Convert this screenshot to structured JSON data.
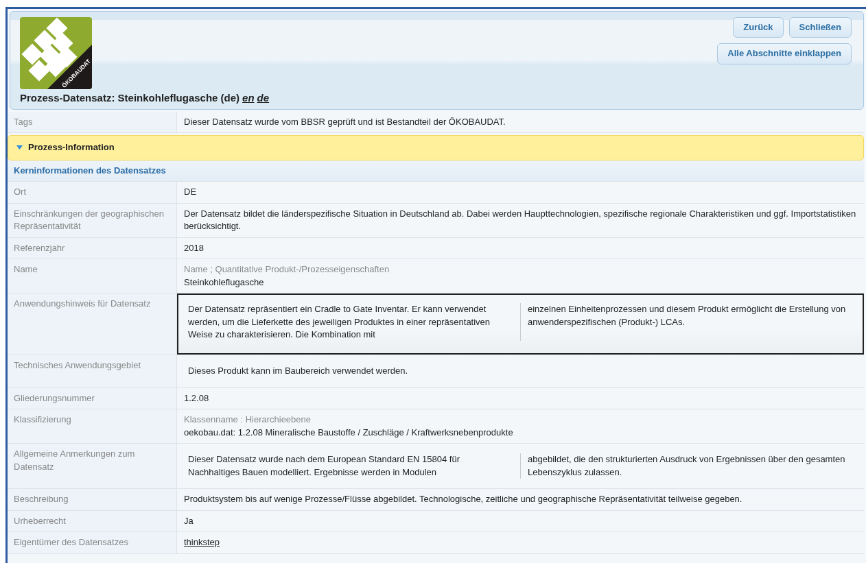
{
  "header": {
    "logo_text": "ÖKOBAUDAT",
    "title": "Prozess-Datensatz: Steinkohleflugasche (de)",
    "languages": [
      {
        "label": "en"
      },
      {
        "label": "de"
      }
    ],
    "buttons": [
      {
        "label": "Zurück"
      },
      {
        "label": "Schließen"
      },
      {
        "label": "Alle Abschnitte einklappen"
      }
    ]
  },
  "tags": {
    "label": "Tags",
    "value": "Dieser Datensatz wurde vom BBSR geprüft und ist Bestandteil der ÖKOBAUDAT."
  },
  "section": {
    "title": "Prozess-Information",
    "expanded": true
  },
  "subsection": "Kerninformationen des Datensatzes",
  "rows": [
    {
      "kind": "text",
      "label": "Ort",
      "value": "DE",
      "focused": false
    },
    {
      "kind": "text",
      "label": "Einschränkungen der geographischen Repräsentativität",
      "value": "Der Datensatz bildet die länderspezifische Situation in Deutschland ab. Dabei werden Haupttechnologien, spezifische regionale Charakteristiken und ggf. Importstatistiken berücksichtigt.",
      "focused": false
    },
    {
      "kind": "text",
      "label": "Referenzjahr",
      "value": "2018",
      "focused": false
    },
    {
      "kind": "qualified",
      "label": "Name",
      "caption": [
        "Name",
        "Quantitative Produkt-/Prozesseigenschaften"
      ],
      "separator": ";",
      "value": "Steinkohleflugasche",
      "focused": false
    },
    {
      "kind": "columns",
      "label": "Anwendungshinweis für Datensatz",
      "columns": [
        "Der Datensatz repräsentiert ein Cradle to Gate Inventar. Er kann verwendet werden, um die Lieferkette des jeweiligen Produktes in einer repräsentativen Weise zu charakterisieren. Die Kombination mit",
        "einzelnen Einheitenprozessen und diesem Produkt ermöglicht die Erstellung von anwenderspezifischen (Produkt-) LCAs."
      ],
      "focused": true
    },
    {
      "kind": "columns",
      "label": "Technisches Anwendungsgebiet",
      "columns": [
        "Dieses Produkt kann im Baubereich verwendet werden."
      ],
      "focused": false
    },
    {
      "kind": "text",
      "label": "Gliederungsnummer",
      "value": "1.2.08",
      "focused": false
    },
    {
      "kind": "qualified",
      "label": "Klassifizierung",
      "caption": [
        "Klassenname",
        "Hierarchieebene"
      ],
      "separator": ":",
      "value": "oekobau.dat: 1.2.08 Mineralische Baustoffe / Zuschläge / Kraftwerksnebenprodukte",
      "focused": false
    },
    {
      "kind": "columns",
      "label": "Allgemeine Anmerkungen zum Datensatz",
      "columns": [
        "Dieser Datensatz wurde nach dem European Standard EN 15804 für Nachhaltiges Bauen modelliert. Ergebnisse werden in Modulen",
        "abgebildet, die den strukturierten Ausdruck von Ergebnissen über den gesamten Lebenszyklus zulassen."
      ],
      "focused": false
    },
    {
      "kind": "text",
      "label": "Beschreibung",
      "value": "Produktsystem bis auf wenige Prozesse/Flüsse abgebildet. Technologische, zeitliche und geographische Repräsentativität teilweise gegeben.",
      "focused": false
    },
    {
      "kind": "text",
      "label": "Urheberrecht",
      "value": "Ja",
      "focused": false
    },
    {
      "kind": "link",
      "label": "Eigentümer des Datensatzes",
      "value": "thinkstep",
      "focused": false
    }
  ]
}
